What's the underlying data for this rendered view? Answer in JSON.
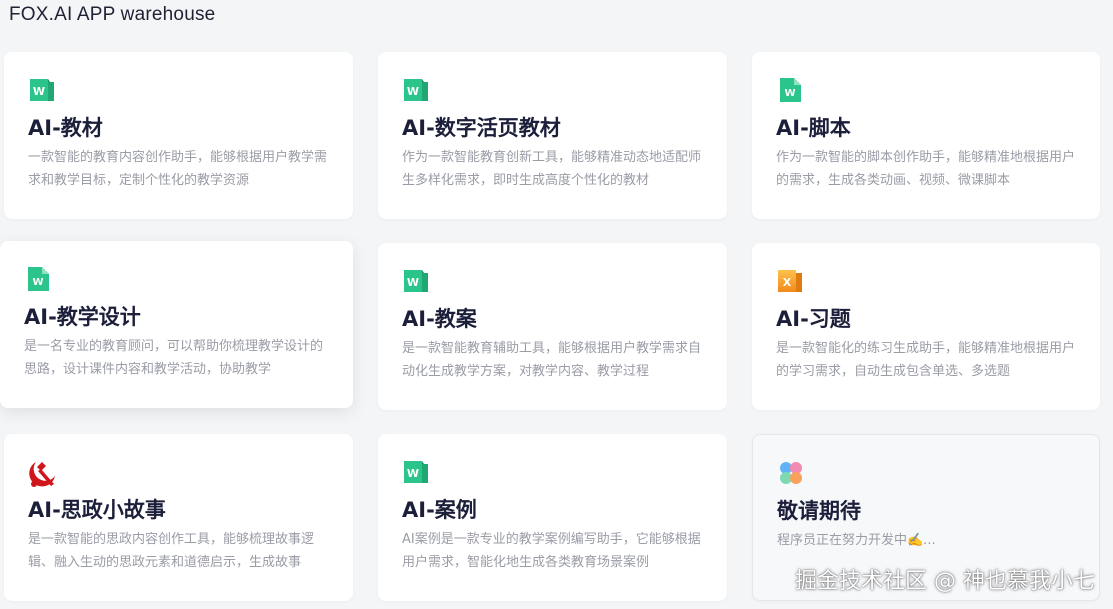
{
  "header": {
    "title": "FOX.AI APP warehouse"
  },
  "cards": [
    {
      "title": "AI-教材",
      "desc": "一款智能的教育内容创作助手，能够根据用户教学需求和教学目标，定制个性化的教学资源",
      "icon": "word-doc-icon"
    },
    {
      "title": "AI-数字活页教材",
      "desc": "作为一款智能教育创新工具，能够精准动态地适配师生多样化需求，即时生成高度个性化的教材",
      "icon": "word-doc-icon"
    },
    {
      "title": "AI-脚本",
      "desc": "作为一款智能的脚本创作助手，能够精准地根据用户的需求，生成各类动画、视频、微课脚本",
      "icon": "word-file-icon"
    },
    {
      "title": "AI-教学设计",
      "desc": "是一名专业的教育顾问，可以帮助你梳理教学设计的思路，设计课件内容和教学活动，协助教学",
      "icon": "word-file-icon"
    },
    {
      "title": "AI-教案",
      "desc": "是一款智能教育辅助工具，能够根据用户教学需求自动化生成教学方案，对教学内容、教学过程",
      "icon": "word-doc-icon"
    },
    {
      "title": "AI-习题",
      "desc": "是一款智能化的练习生成助手，能够精准地根据用户的学习需求，自动生成包含单选、多选题",
      "icon": "excel-icon"
    },
    {
      "title": "AI-思政小故事",
      "desc": "是一款智能的思政内容创作工具，能够梳理故事逻辑、融入生动的思政元素和道德启示，生成故事",
      "icon": "hammer-sickle-icon"
    },
    {
      "title": "AI-案例",
      "desc": "AI案例是一款专业的教学案例编写助手，它能够根据用户需求，智能化地生成各类教育场景案例",
      "icon": "word-doc-icon"
    },
    {
      "title": "敬请期待",
      "desc": "程序员正在努力开发中✍️...",
      "icon": "clover-icon"
    }
  ],
  "watermark": {
    "text": "掘金技术社区 @ 神也慕我小七"
  },
  "colors": {
    "word_green": "#2bc48a",
    "excel_orange": "#f5a623",
    "emblem_red": "#d0161d"
  }
}
